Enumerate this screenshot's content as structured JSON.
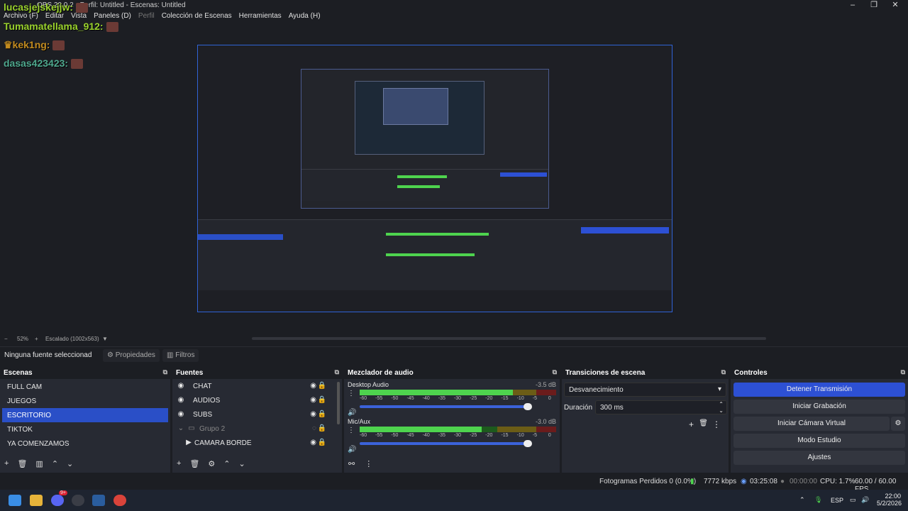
{
  "window": {
    "title": "OBS 29.0.2 - Perfil: Untitled - Escenas: Untitled"
  },
  "menu": [
    "Archivo (F)",
    "Editar",
    "Vista",
    "Paneles (D)",
    "Perfil",
    "Colección de Escenas",
    "Herramientas",
    "Ayuda (H)"
  ],
  "chat": [
    {
      "user": "lucasjejskejjw:",
      "color": "#9ad22d"
    },
    {
      "user": "Tumamatellama_912:",
      "color": "#9ad22d"
    },
    {
      "user": "kek1ng:",
      "color": "#c28b1f"
    },
    {
      "user": "dasas423423:",
      "color": "#4fa88e"
    }
  ],
  "zoom": {
    "minus": "−",
    "pct": "52%",
    "plus": "+",
    "scaled": "Escalado (1002x563)",
    "caret": "▼"
  },
  "props": {
    "no_source": "Ninguna fuente seleccionad",
    "properties": "Propiedades",
    "filters": "Filtros"
  },
  "scenes": {
    "title": "Escenas",
    "items": [
      "FULL CAM",
      "JUEGOS",
      "ESCRITORIO",
      "TIKTOK",
      "YA COMENZAMOS"
    ],
    "selected": 2
  },
  "sources": {
    "title": "Fuentes",
    "items": [
      "CHAT",
      "AUDIOS",
      "SUBS",
      "Grupo 2",
      "CAMARA BORDE"
    ]
  },
  "mixer": {
    "title": "Mezclador de audio",
    "channels": [
      {
        "name": "Desktop Audio",
        "db": "-3.5 dB",
        "level": 0.78
      },
      {
        "name": "Mic/Aux",
        "db": "-3.0 dB",
        "level": 0.62
      }
    ],
    "ticks": [
      "-60",
      "-55",
      "-50",
      "-45",
      "-40",
      "-35",
      "-30",
      "-25",
      "-20",
      "-15",
      "-10",
      "-5",
      "0"
    ]
  },
  "transitions": {
    "title": "Transiciones de escena",
    "selected": "Desvanecimiento",
    "duration_label": "Duración",
    "duration": "300 ms"
  },
  "controls": {
    "title": "Controles",
    "stop_stream": "Detener Transmisión",
    "start_rec": "Iniciar Grabación",
    "start_vcam": "Iniciar Cámara Virtual",
    "studio": "Modo Estudio",
    "settings": "Ajustes"
  },
  "status": {
    "dropped": "Fotogramas Perdidos 0 (0.0%)",
    "bitrate": "7772 kbps",
    "stream_time": "03:25:08",
    "rec_time": "00:00:00",
    "cpu": "CPU: 1.7%",
    "fps": "60.00 / 60.00 FPS"
  },
  "taskbar": {
    "lang": "ESP",
    "time": "22:00",
    "date": "5/2/2026",
    "badge": "9+"
  },
  "colors": {
    "accent": "#2d50d4",
    "bg": "#1c1e23",
    "panel": "#272a33"
  }
}
